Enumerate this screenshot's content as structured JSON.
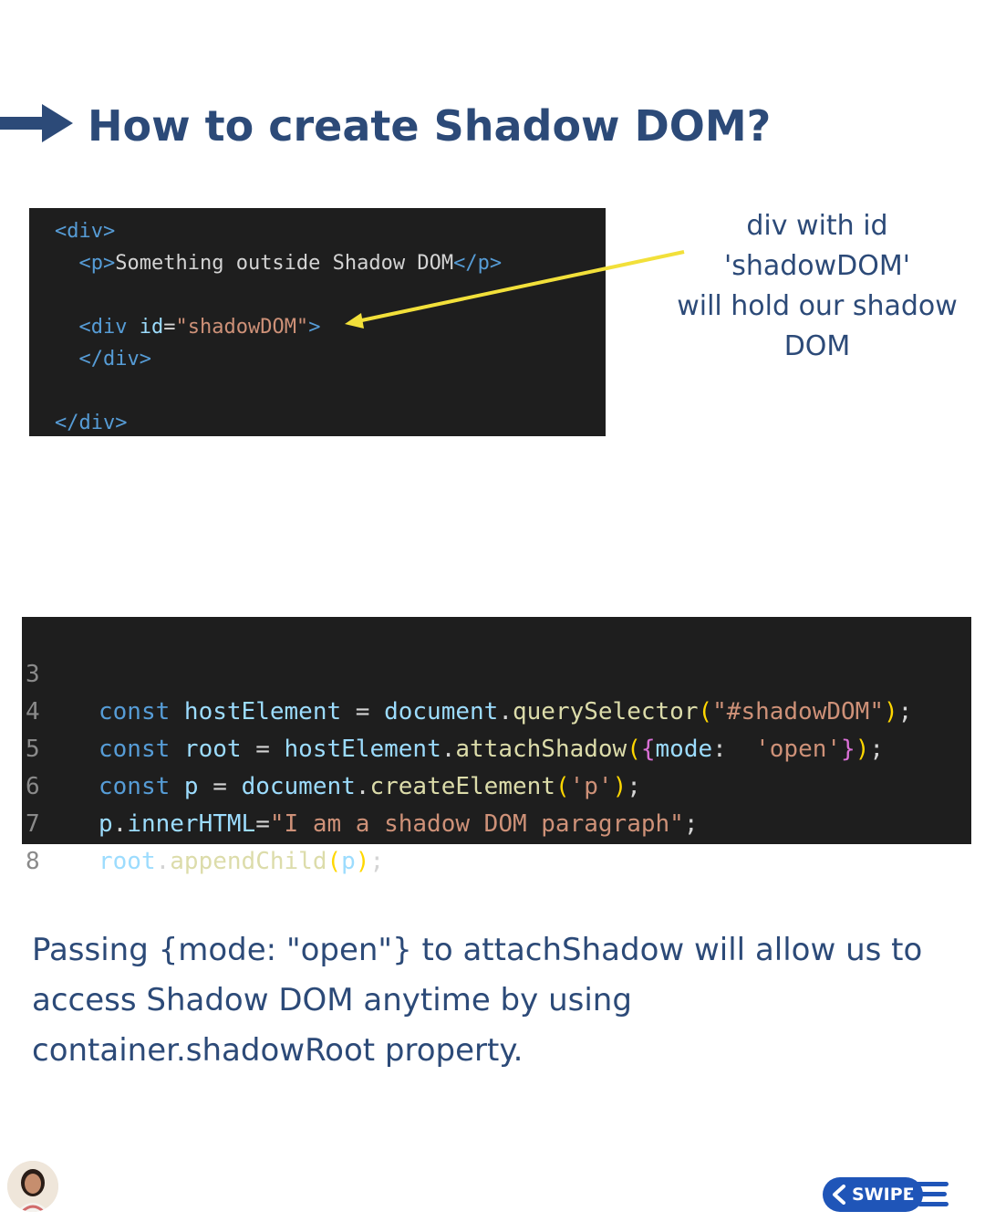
{
  "header": {
    "title": "How to create Shadow DOM?",
    "arrow_icon": "right-arrow-icon",
    "color": "#2c4a78"
  },
  "code_block_html": {
    "lines": [
      [
        "<div>"
      ],
      [
        "<p>",
        "Something outside Shadow DOM",
        "</p>"
      ],
      [],
      [
        "<div ",
        "id",
        "=",
        "\"shadowDOM\"",
        ">"
      ],
      [
        "</div>"
      ],
      [],
      [
        "</div>"
      ]
    ]
  },
  "annotation": {
    "lines": [
      "div with id",
      "'shadowDOM'",
      "will hold our shadow",
      "DOM"
    ],
    "pointer_color": "#f2e03a"
  },
  "code_block_js": {
    "line_numbers": [
      "3",
      "4",
      "5",
      "6",
      "7",
      "8"
    ],
    "lines": [
      [
        "const",
        " hostElement",
        " = ",
        "document",
        ".",
        "querySelector",
        "(",
        "\"#shadowDOM\"",
        ")",
        ";"
      ],
      [
        "const",
        " root",
        " = ",
        "hostElement",
        ".",
        "attachShadow",
        "(",
        "{",
        "mode",
        ":  ",
        "'open'",
        "}",
        ")",
        ";"
      ],
      [
        "const",
        " p",
        " = ",
        "document",
        ".",
        "createElement",
        "(",
        "'p'",
        ")",
        ";"
      ],
      [
        "p",
        ".",
        "innerHTML",
        "=",
        "\"I am a shadow DOM paragraph\"",
        ";"
      ],
      [
        "root",
        ".",
        "appendChild",
        "(",
        "p",
        ")",
        ";"
      ],
      []
    ]
  },
  "description": {
    "text": "Passing {mode: \"open\"} to attachShadow will allow us to access Shadow DOM anytime by using container.shadowRoot property."
  },
  "footer": {
    "swipe_label": "SWIPE",
    "swipe_color": "#1f55b8",
    "avatar_icon": "author-avatar-icon"
  }
}
